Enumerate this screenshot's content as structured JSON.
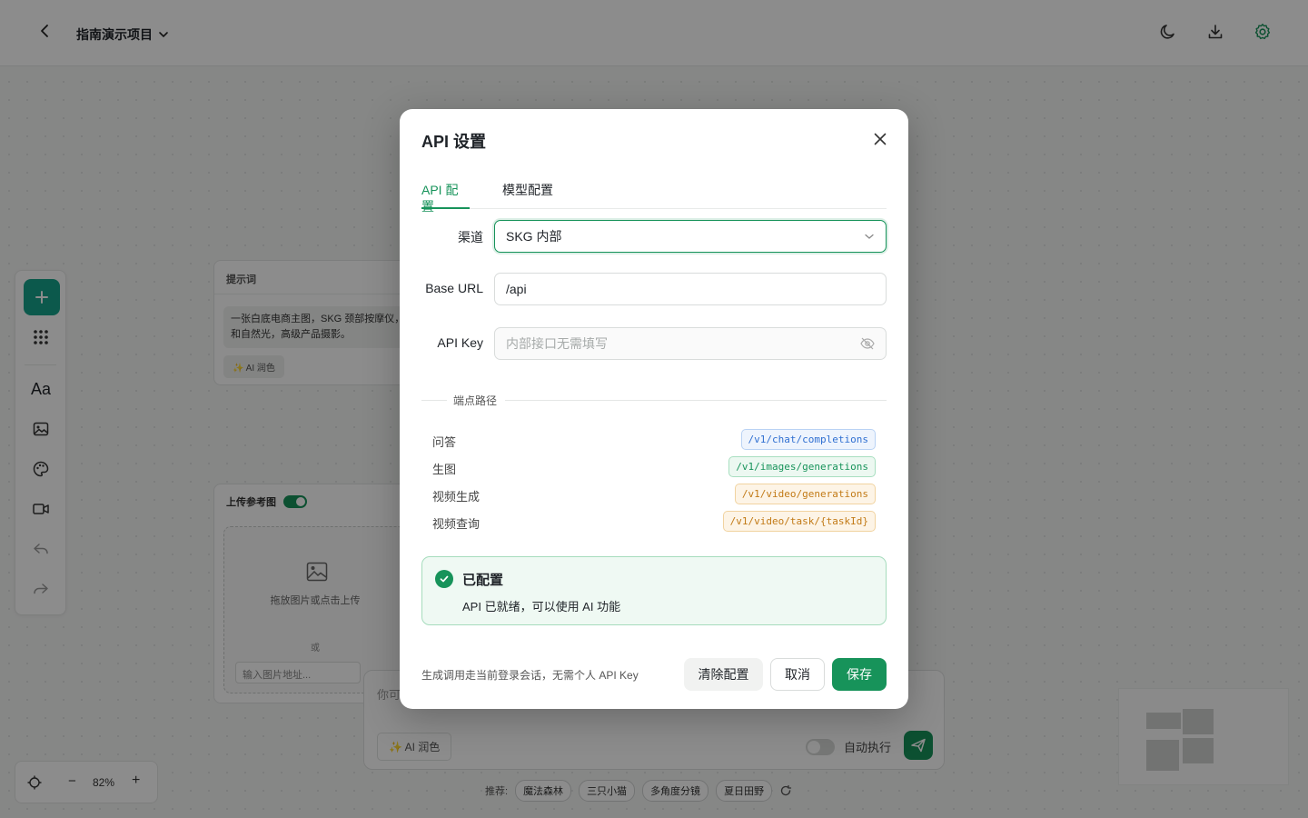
{
  "topbar": {
    "project_name": "指南演示项目",
    "icons": [
      "back-arrow-icon",
      "chevron-down-icon",
      "moon-icon",
      "download-icon",
      "gear-icon"
    ],
    "accent_color": "#17935a"
  },
  "toolbar": {
    "icons": [
      "plus-icon",
      "grid-icon",
      "text-icon",
      "image-icon",
      "palette-icon",
      "video-icon",
      "undo-icon",
      "redo-icon"
    ],
    "text_tool_label": "Aa"
  },
  "canvas": {
    "prompt_node": {
      "title": "提示词",
      "text": "一张白底电商主图，SKG 颈部按摩仪，柔和自然光，高级产品摄影。",
      "ai_button": "✨ AI 润色"
    },
    "upload_node": {
      "title": "上传参考图",
      "drop_text": "拖放图片或点击上传",
      "or_text": "或",
      "url_placeholder": "输入图片地址..."
    },
    "chat": {
      "placeholder": "你可",
      "ai_button": "✨ AI 润色",
      "auto_run_label": "自动执行"
    },
    "recommend": {
      "label": "推荐:",
      "chips": [
        "魔法森林",
        "三只小猫",
        "多角度分镜",
        "夏日田野"
      ]
    },
    "zoom": {
      "level": "82%",
      "minus": "−",
      "plus": "+"
    }
  },
  "modal": {
    "title": "API 设置",
    "tabs": [
      {
        "label": "API 配置",
        "active": true
      },
      {
        "label": "模型配置",
        "active": false
      }
    ],
    "channel": {
      "label": "渠道",
      "value": "SKG 内部"
    },
    "base_url": {
      "label": "Base URL",
      "value": "/api"
    },
    "api_key": {
      "label": "API Key",
      "placeholder": "内部接口无需填写"
    },
    "endpoints_title": "端点路径",
    "endpoints": [
      {
        "label": "问答",
        "path": "/v1/chat/completions",
        "color": "#2f6fd1"
      },
      {
        "label": "生图",
        "path": "/v1/images/generations",
        "color": "#17935a"
      },
      {
        "label": "视频生成",
        "path": "/v1/video/generations",
        "color": "#c27a16"
      },
      {
        "label": "视频查询",
        "path": "/v1/video/task/{taskId}",
        "color": "#c27a16"
      }
    ],
    "status": {
      "title": "已配置",
      "desc": "API 已就绪，可以使用 AI 功能"
    },
    "footer_note": "生成调用走当前登录会话，无需个人 API Key",
    "buttons": {
      "clear": "清除配置",
      "cancel": "取消",
      "save": "保存"
    }
  }
}
